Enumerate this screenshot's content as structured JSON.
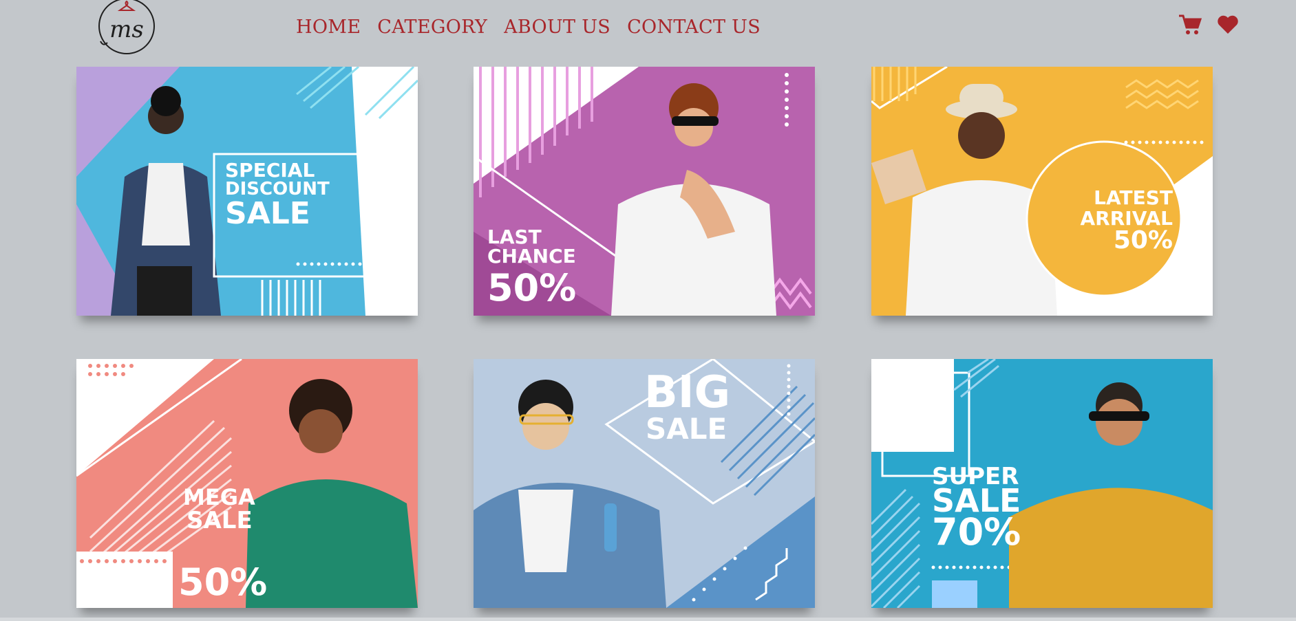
{
  "header": {
    "logo_text": "ms",
    "nav": [
      {
        "label": "HOME"
      },
      {
        "label": "CATEGORY"
      },
      {
        "label": "ABOUT US"
      },
      {
        "label": "CONTACT US"
      }
    ],
    "icons": [
      "cart-icon",
      "heart-icon"
    ],
    "accent_color": "#a8262b"
  },
  "banners": [
    {
      "lines": [
        "SPECIAL",
        "DISCOUNT",
        "SALE"
      ],
      "color": "#4fb7dd"
    },
    {
      "lines": [
        "LAST",
        "CHANCE",
        "50%"
      ],
      "color": "#b863ae"
    },
    {
      "lines": [
        "LATEST",
        "ARRIVAL",
        "50%"
      ],
      "color": "#f4b63c"
    },
    {
      "lines": [
        "MEGA",
        "SALE",
        "50%"
      ],
      "color": "#f08a80"
    },
    {
      "lines": [
        "BIG",
        "SALE"
      ],
      "color": "#b9cbe0"
    },
    {
      "lines": [
        "SUPER",
        "SALE",
        "70%"
      ],
      "color": "#2aa6cc"
    }
  ],
  "page_background": "#c3c7cb"
}
